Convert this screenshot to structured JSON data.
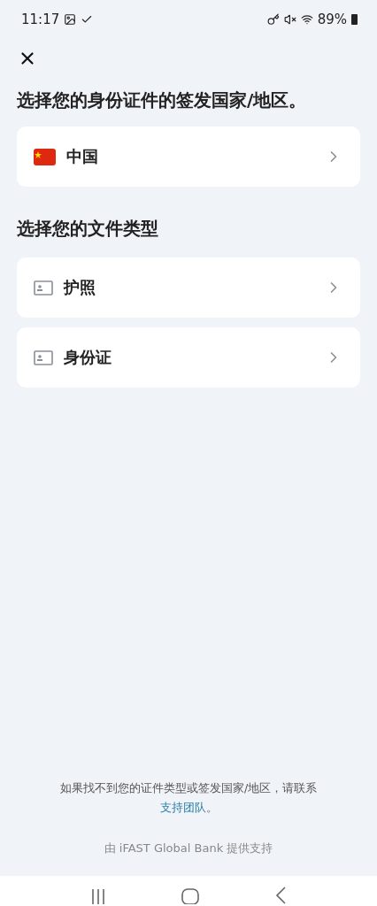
{
  "status_bar": {
    "time": "11:17",
    "battery": "89%"
  },
  "title": "选择您的身份证件的签发国家/地区。",
  "country": {
    "name": "中国"
  },
  "document_heading": "选择您的文件类型",
  "documents": [
    {
      "label": "护照"
    },
    {
      "label": "身份证"
    }
  ],
  "help": {
    "text": "如果找不到您的证件类型或签发国家/地区，请联系",
    "link": "支持团队",
    "end": "。"
  },
  "powered_by": "由 iFAST Global Bank 提供支持"
}
